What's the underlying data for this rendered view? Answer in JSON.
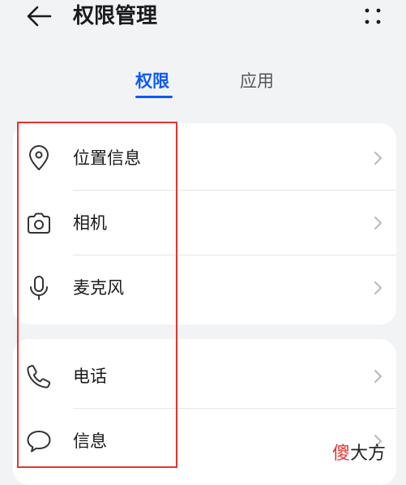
{
  "header": {
    "title": "权限管理"
  },
  "tabs": [
    {
      "label": "权限",
      "active": true
    },
    {
      "label": "应用",
      "active": false
    }
  ],
  "groups": [
    {
      "items": [
        {
          "label": "位置信息",
          "icon": "location-pin-icon"
        },
        {
          "label": "相机",
          "icon": "camera-icon"
        },
        {
          "label": "麦克风",
          "icon": "microphone-icon"
        }
      ]
    },
    {
      "items": [
        {
          "label": "电话",
          "icon": "phone-icon"
        },
        {
          "label": "信息",
          "icon": "message-bubble-icon"
        }
      ]
    }
  ],
  "watermark": {
    "first": "傻",
    "rest": "大方"
  },
  "colors": {
    "accent": "#0a59f7",
    "background": "#f1f3f5",
    "card": "#ffffff",
    "highlight": "#e8332f"
  }
}
